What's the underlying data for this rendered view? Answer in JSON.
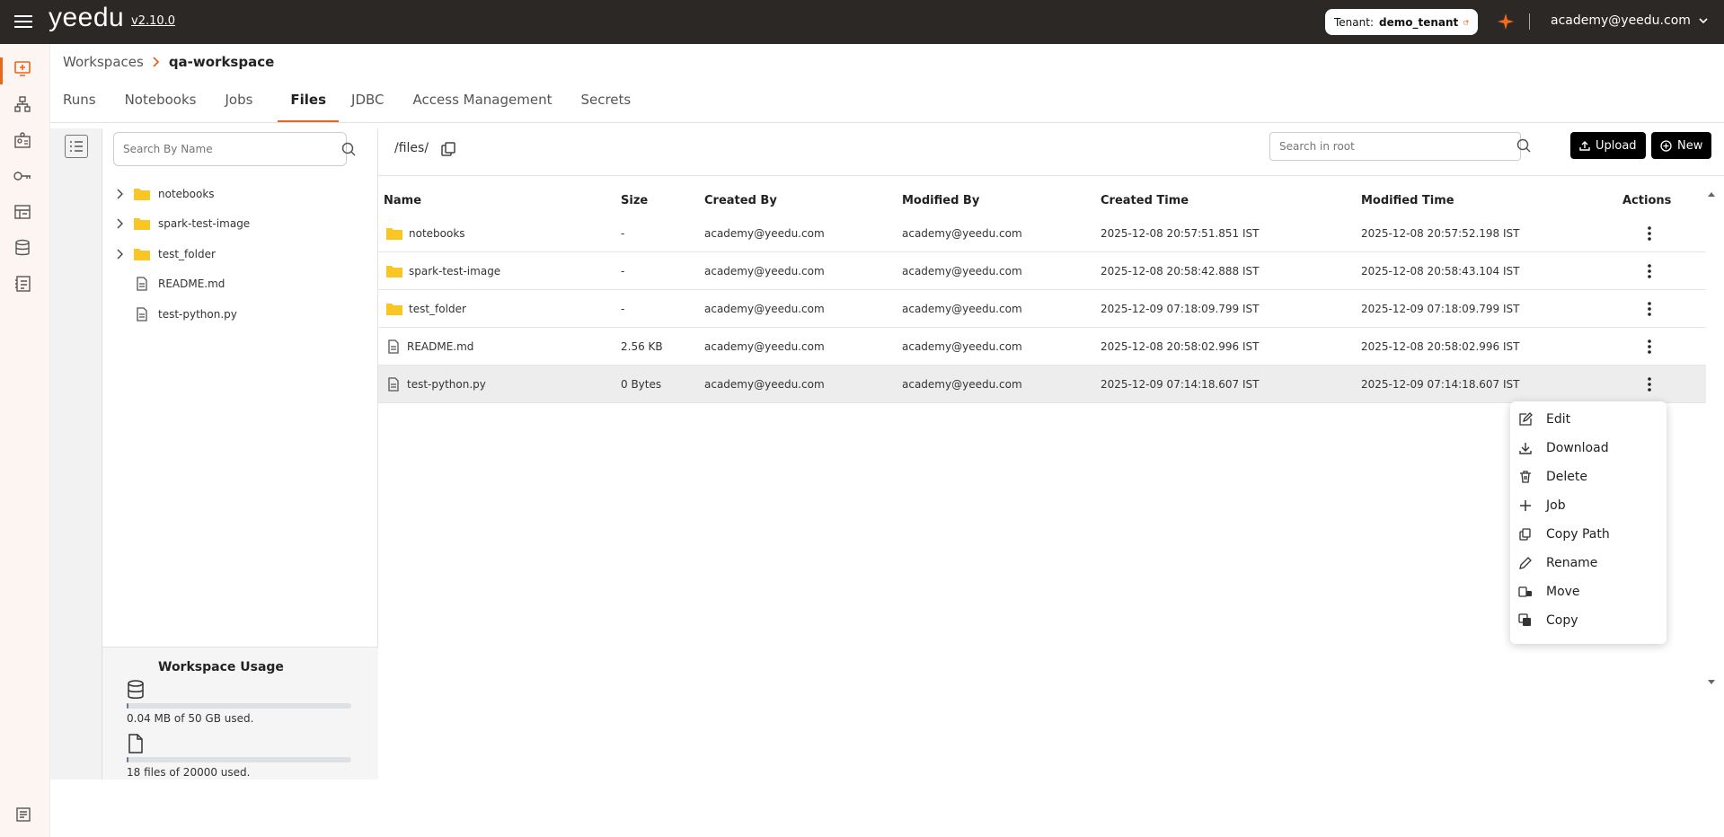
{
  "app": {
    "logo": "yeedu",
    "version": "v2.10.0",
    "tenant_label": "Tenant:",
    "tenant_value": "demo_tenant",
    "user": "academy@yeedu.com",
    "accent": "#e8671f"
  },
  "rail": {
    "items": [
      "workspaces-icon",
      "clusters-icon",
      "profile-icon",
      "keys-icon",
      "tenants-icon",
      "database-icon",
      "billing-icon",
      "docs-icon"
    ]
  },
  "breadcrumb": {
    "parent": "Workspaces",
    "current": "qa-workspace"
  },
  "tabs": [
    "Runs",
    "Notebooks",
    "Jobs",
    "Files",
    "JDBC",
    "Access Management",
    "Secrets"
  ],
  "active_tab": "Files",
  "tree": {
    "search_placeholder": "Search By Name",
    "items": [
      {
        "name": "notebooks",
        "type": "folder"
      },
      {
        "name": "spark-test-image",
        "type": "folder"
      },
      {
        "name": "test_folder",
        "type": "folder"
      },
      {
        "name": "README.md",
        "type": "file"
      },
      {
        "name": "test-python.py",
        "type": "file"
      }
    ]
  },
  "usage": {
    "title": "Workspace Usage",
    "storage_text": "0.04 MB of 50 GB used.",
    "storage_fraction": 0.0008,
    "files_text": "18 files of 20000 used.",
    "files_fraction": 0.0009
  },
  "files": {
    "path": "/files/",
    "search_placeholder": "Search in root",
    "upload_label": "Upload",
    "new_label": "New",
    "columns": [
      "Name",
      "Size",
      "Created By",
      "Modified By",
      "Created Time",
      "Modified Time",
      "Actions"
    ],
    "rows": [
      {
        "name": "notebooks",
        "type": "folder",
        "size": "-",
        "created_by": "academy@yeedu.com",
        "modified_by": "academy@yeedu.com",
        "created": "2025-12-08 20:57:51.851 IST",
        "modified": "2025-12-08 20:57:52.198 IST"
      },
      {
        "name": "spark-test-image",
        "type": "folder",
        "size": "-",
        "created_by": "academy@yeedu.com",
        "modified_by": "academy@yeedu.com",
        "created": "2025-12-08 20:58:42.888 IST",
        "modified": "2025-12-08 20:58:43.104 IST"
      },
      {
        "name": "test_folder",
        "type": "folder",
        "size": "-",
        "created_by": "academy@yeedu.com",
        "modified_by": "academy@yeedu.com",
        "created": "2025-12-09 07:18:09.799 IST",
        "modified": "2025-12-09 07:18:09.799 IST"
      },
      {
        "name": "README.md",
        "type": "file",
        "size": "2.56 KB",
        "created_by": "academy@yeedu.com",
        "modified_by": "academy@yeedu.com",
        "created": "2025-12-08 20:58:02.996 IST",
        "modified": "2025-12-08 20:58:02.996 IST"
      },
      {
        "name": "test-python.py",
        "type": "file",
        "size": "0 Bytes",
        "created_by": "academy@yeedu.com",
        "modified_by": "academy@yeedu.com",
        "created": "2025-12-09 07:14:18.607 IST",
        "modified": "2025-12-09 07:14:18.607 IST"
      }
    ]
  },
  "context_menu": {
    "items": [
      {
        "label": "Edit",
        "icon": "edit-icon"
      },
      {
        "label": "Download",
        "icon": "download-icon"
      },
      {
        "label": "Delete",
        "icon": "trash-icon"
      },
      {
        "label": "Job",
        "icon": "plus-icon"
      },
      {
        "label": "Copy Path",
        "icon": "copy-path-icon"
      },
      {
        "label": "Rename",
        "icon": "pencil-icon"
      },
      {
        "label": "Move",
        "icon": "move-icon"
      },
      {
        "label": "Copy",
        "icon": "copy-icon"
      }
    ]
  }
}
